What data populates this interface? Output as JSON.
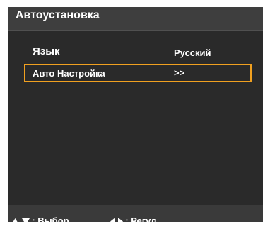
{
  "window": {
    "title": "Автоустановка"
  },
  "menu": {
    "items": [
      {
        "label": "Язык",
        "value": "Русский"
      },
      {
        "label": "Авто Настройка",
        "value": ">>"
      }
    ],
    "selected_index": 1
  },
  "footer": {
    "select_hint": ": Выбор",
    "adjust_hint": ": Регул.",
    "select_icons": [
      "up-triangle-icon",
      "down-triangle-icon"
    ],
    "adjust_icons": [
      "left-triangle-icon",
      "right-triangle-icon"
    ]
  },
  "colors": {
    "panel_bg": "#2a2a2a",
    "title_bg": "#3e3e3e",
    "footer_bg": "#3a3a3a",
    "highlight_border": "#f0a020",
    "text": "#ffffff"
  }
}
